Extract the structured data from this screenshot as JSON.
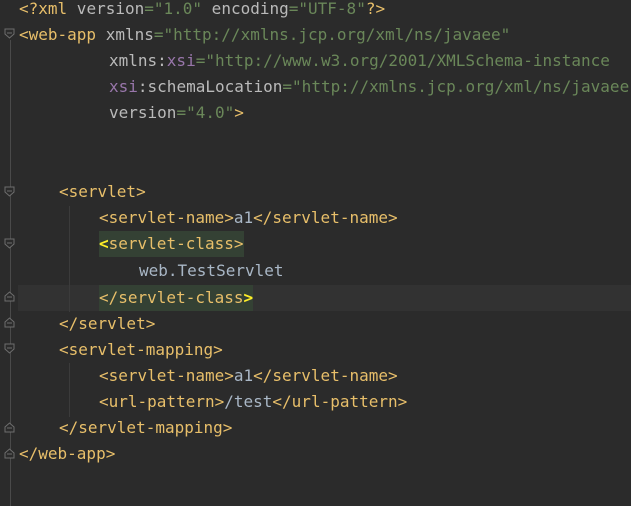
{
  "editor": {
    "colors": {
      "background": "#2b2b2b",
      "tag": "#e8bf6a",
      "attribute": "#bababa",
      "namespace": "#9876aa",
      "string": "#6a8759",
      "text": "#a9b7c6",
      "tag_highlight": "#344134",
      "caret_line": "#323232"
    },
    "lines": [
      {
        "decl_open": "<?xml",
        "a1": " version",
        "eq1": "=",
        "v1": "\"1.0\"",
        "a2": " encoding",
        "eq2": "=",
        "v2": "\"UTF-8\"",
        "decl_close": "?>"
      },
      {
        "open": "<web-app",
        "attr": " xmlns",
        "eq": "=",
        "val": "\"http://xmlns.jcp.org/xml/ns/javaee\""
      },
      {
        "attr": "xmlns:",
        "ns": "xsi",
        "eq": "=",
        "val": "\"http://www.w3.org/2001/XMLSchema-instance"
      },
      {
        "ns": "xsi",
        "attr": ":schemaLocation",
        "eq": "=",
        "val": "\"http://xmlns.jcp.org/xml/ns/javaee"
      },
      {
        "attr": "version",
        "eq": "=",
        "val": "\"4.0\"",
        "close": ">"
      },
      {
        "tag": "<servlet>"
      },
      {
        "open": "<servlet-name>",
        "text": "a1",
        "close": "</servlet-name>"
      },
      {
        "lt": "<",
        "tag": "servlet-class",
        "gt": ">"
      },
      {
        "text": "web.TestServlet"
      },
      {
        "lt": "</",
        "tag": "servlet-class",
        "gt": ">"
      },
      {
        "tag": "</servlet>"
      },
      {
        "tag": "<servlet-mapping>"
      },
      {
        "open": "<servlet-name>",
        "text": "a1",
        "close": "</servlet-name>"
      },
      {
        "open": "<url-pattern>",
        "text": "/test",
        "close": "</url-pattern>"
      },
      {
        "tag": "</servlet-mapping>"
      },
      {
        "tag": "</web-app>"
      }
    ]
  }
}
